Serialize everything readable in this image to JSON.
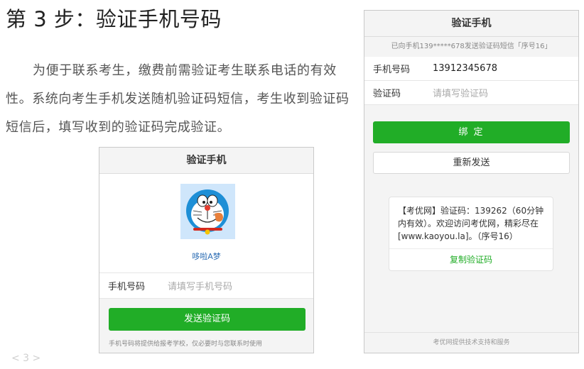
{
  "step": {
    "title": "第 3 步：验证手机号码"
  },
  "intro": {
    "text": "为便于联系考生，缴费前需验证考生联系电话的有效性。系统向考生手机发送随机验证码短信，考生收到验证码短信后，填写收到的验证码完成验证。"
  },
  "pagination": {
    "label": "< 3 >"
  },
  "phone_a": {
    "header": "验证手机",
    "nickname": "哆啦A梦",
    "phone_label": "手机号码",
    "phone_placeholder": "请填写手机号码",
    "send_button": "发送验证码",
    "footer": "手机号码将提供给报考学校，仅必要时与您联系时使用"
  },
  "phone_b": {
    "header": "验证手机",
    "notice": "已向手机139*****678发送验证码短信「序号16」",
    "phone_label": "手机号码",
    "phone_value": "13912345678",
    "code_label": "验证码",
    "code_placeholder": "请填写验证码",
    "bind_button": "绑 定",
    "resend_button": "重新发送",
    "sms_text": "【考优网】验证码：139262（60分钟内有效）。欢迎访问考优网，精彩尽在[www.kaoyou.la]。（序号16）",
    "copy_button": "复制验证码",
    "footer": "考优网提供技术支持和服务"
  },
  "colors": {
    "accent": "#21ad27",
    "link": "#2f6fb5"
  },
  "icons": {
    "avatar": "doraemon-avatar"
  }
}
